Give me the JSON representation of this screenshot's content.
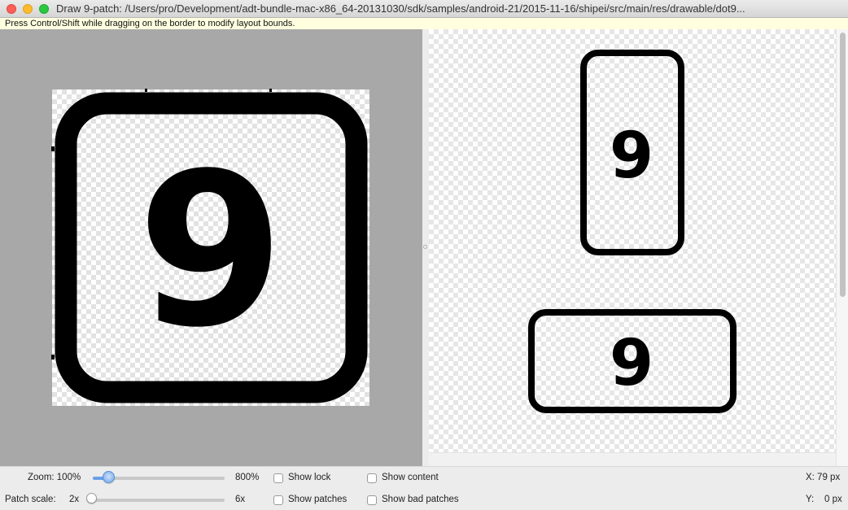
{
  "window": {
    "title": "Draw 9-patch: /Users/pro/Development/adt-bundle-mac-x86_64-20131030/sdk/samples/android-21/2015-11-16/shipei/src/main/res/drawable/dot9..."
  },
  "hint": "Press Control/Shift while dragging on the border to modify layout bounds.",
  "editor": {
    "glyph": "9"
  },
  "preview": {
    "vertical_glyph": "9",
    "horizontal_glyph": "9"
  },
  "controls": {
    "zoom_label": "Zoom: 100%",
    "zoom_max": "800%",
    "zoom_level": 0.02,
    "patch_scale_label": "Patch scale:",
    "patch_scale_min": "2x",
    "patch_scale_max": "6x",
    "patch_scale_level": 0.0,
    "show_lock": {
      "label": "Show lock",
      "checked": false
    },
    "show_content": {
      "label": "Show content",
      "checked": false
    },
    "show_patches": {
      "label": "Show patches",
      "checked": false
    },
    "show_bad_patches": {
      "label": "Show bad patches",
      "checked": false
    },
    "x_readout": "X: 79 px",
    "y_readout": "Y:    0 px"
  },
  "colors": {
    "editor_background": "#a8a8a8",
    "checker_light": "#ffffff",
    "checker_dark": "#e6e6e6",
    "ink": "#000000",
    "slider_accent": "#6aa0e8"
  },
  "icons": [
    "close-window-icon",
    "minimize-window-icon",
    "maximize-window-icon",
    "checkbox-icon",
    "slider-knob-icon"
  ]
}
